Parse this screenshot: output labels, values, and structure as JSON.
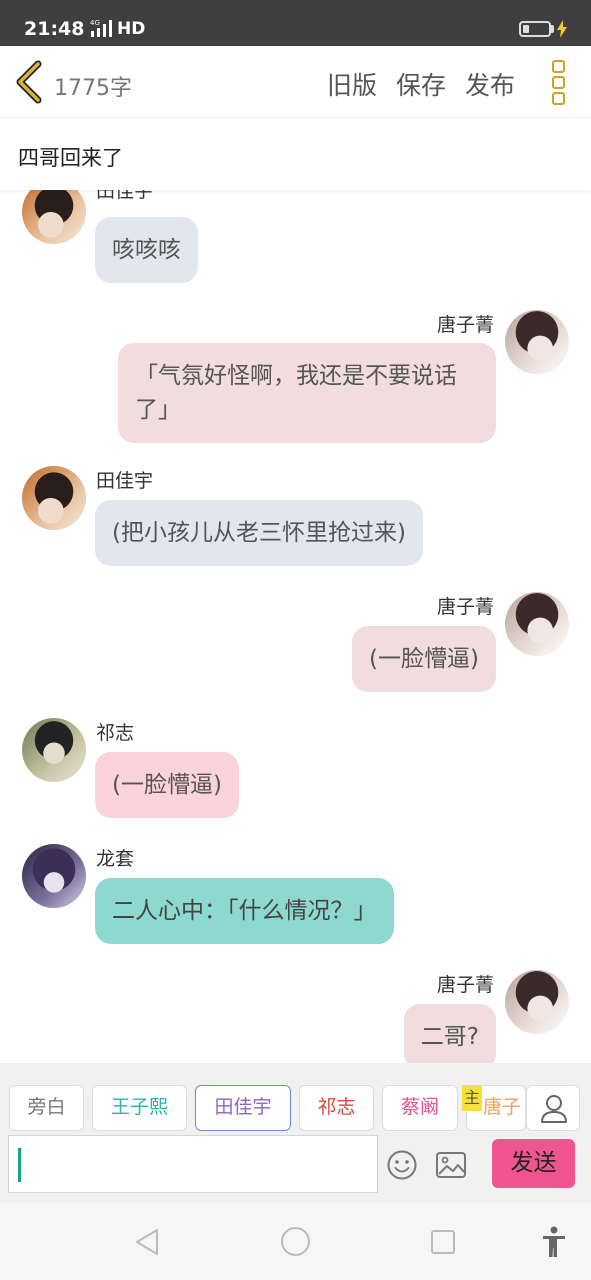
{
  "status_bar": {
    "time": "21:48",
    "network": "HD",
    "network_badge": "4G"
  },
  "header": {
    "word_count": "1775字",
    "menu": [
      "旧版",
      "保存",
      "发布"
    ]
  },
  "chapter": {
    "title": "四哥回来了"
  },
  "messages": [
    {
      "side": "left",
      "speaker": "田佳宇",
      "avatar": "tian-avatar",
      "text": "咳咳咳"
    },
    {
      "side": "right",
      "speaker": "唐子菁",
      "avatar": "tang-avatar",
      "text": "「气氛好怪啊，我还是不要说话了」"
    },
    {
      "side": "left",
      "speaker": "田佳宇",
      "avatar": "tian-avatar",
      "text": "(把小孩儿从老三怀里抢过来)"
    },
    {
      "side": "right",
      "speaker": "唐子菁",
      "avatar": "tang-avatar",
      "text": "(一脸懵逼)"
    },
    {
      "side": "left",
      "speaker": "祁志",
      "avatar": "qi-avatar",
      "text": "(一脸懵逼)"
    },
    {
      "side": "left",
      "speaker": "龙套",
      "avatar": "long-avatar",
      "text": "二人心中：「什么情况？」"
    },
    {
      "side": "right",
      "speaker": "唐子菁",
      "avatar": "tang-avatar",
      "text": "二哥?"
    }
  ],
  "character_bar": {
    "characters": [
      {
        "label": "旁白",
        "color": "#777777",
        "selected": false
      },
      {
        "label": "王子熙",
        "color": "#2ab3a6",
        "selected": false
      },
      {
        "label": "田佳宇",
        "color": "#8e63c9",
        "selected": true
      },
      {
        "label": "祁志",
        "color": "#e0453f",
        "selected": false
      },
      {
        "label": "蔡阚",
        "color": "#e0558f",
        "selected": false
      },
      {
        "label": "唐子",
        "color": "#f0a060",
        "selected": false
      }
    ],
    "host_badge": "主",
    "input_value": "",
    "send_label": "发送"
  },
  "colors": {
    "accent": "#f0558f",
    "more_icon": "#c9a227",
    "back_icon": "#c9a227"
  },
  "icons": [
    "back-chevron-icon",
    "more-icon",
    "user-icon",
    "emoji-icon",
    "image-icon",
    "nav-back-icon",
    "nav-home-icon",
    "nav-recent-icon",
    "accessibility-icon"
  ]
}
